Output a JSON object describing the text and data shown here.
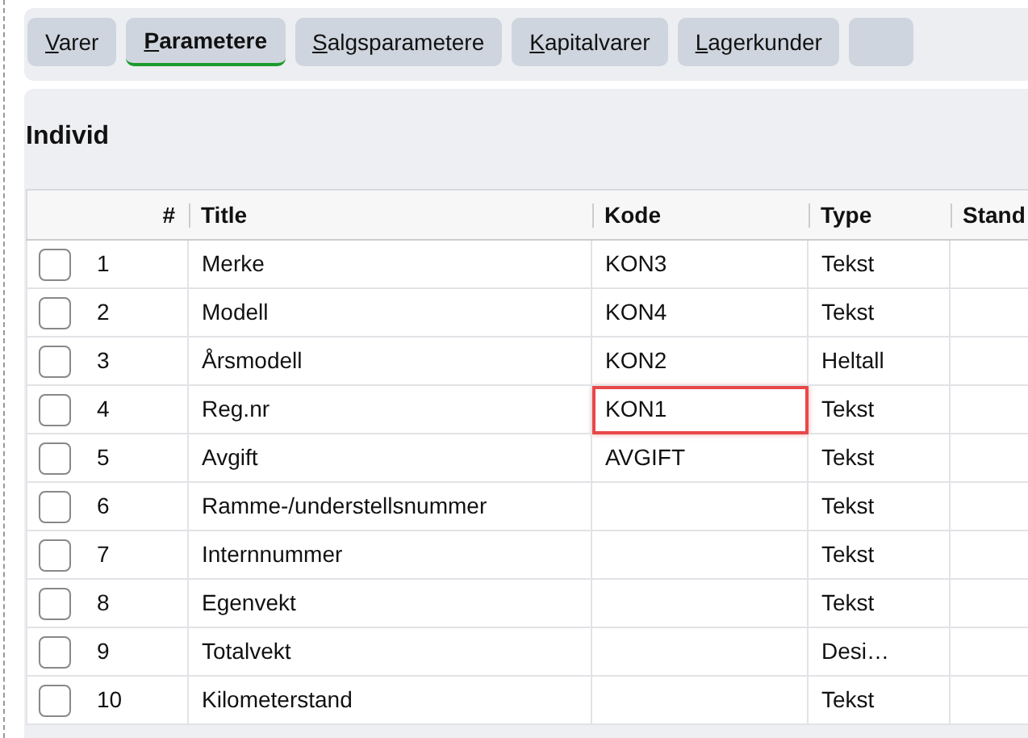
{
  "tabs": [
    {
      "label": "Varer",
      "selected": false
    },
    {
      "label": "Parametere",
      "selected": true
    },
    {
      "label": "Salgsparametere",
      "selected": false
    },
    {
      "label": "Kapitalvarer",
      "selected": false
    },
    {
      "label": "Lagerkunder",
      "selected": false
    }
  ],
  "section": {
    "title": "Individ"
  },
  "table": {
    "columns": [
      "#",
      "Title",
      "Kode",
      "Type",
      "Stand"
    ],
    "rows": [
      {
        "checked": false,
        "number": "1",
        "title": "Merke",
        "kode": "KON3",
        "type": "Tekst",
        "highlighted": false
      },
      {
        "checked": false,
        "number": "2",
        "title": "Modell",
        "kode": "KON4",
        "type": "Tekst",
        "highlighted": false
      },
      {
        "checked": false,
        "number": "3",
        "title": "Årsmodell",
        "kode": "KON2",
        "type": "Heltall",
        "highlighted": false
      },
      {
        "checked": false,
        "number": "4",
        "title": "Reg.nr",
        "kode": "KON1",
        "type": "Tekst",
        "highlighted": true
      },
      {
        "checked": false,
        "number": "5",
        "title": "Avgift",
        "kode": "AVGIFT",
        "type": "Tekst",
        "highlighted": false
      },
      {
        "checked": false,
        "number": "6",
        "title": "Ramme-/understellsnummer",
        "kode": "",
        "type": "Tekst",
        "highlighted": false
      },
      {
        "checked": false,
        "number": "7",
        "title": "Internnummer",
        "kode": "",
        "type": "Tekst",
        "highlighted": false
      },
      {
        "checked": false,
        "number": "8",
        "title": "Egenvekt",
        "kode": "",
        "type": "Tekst",
        "highlighted": false
      },
      {
        "checked": false,
        "number": "9",
        "title": "Totalvekt",
        "kode": "",
        "type": "Desi…",
        "highlighted": false
      },
      {
        "checked": false,
        "number": "10",
        "title": "Kilometerstand",
        "kode": "",
        "type": "Tekst",
        "highlighted": false
      }
    ]
  }
}
